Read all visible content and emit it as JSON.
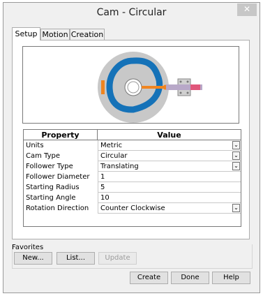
{
  "window": {
    "title": "Cam - Circular",
    "close_symbol": "✕"
  },
  "tabs": [
    {
      "label": "Setup",
      "active": true
    },
    {
      "label": "Motion",
      "active": false
    },
    {
      "label": "Creation",
      "active": false
    }
  ],
  "properties": {
    "header_property": "Property",
    "header_value": "Value",
    "rows": [
      {
        "name": "Units",
        "value": "Metric",
        "dropdown": true
      },
      {
        "name": "Cam Type",
        "value": "Circular",
        "dropdown": true
      },
      {
        "name": "Follower Type",
        "value": "Translating",
        "dropdown": true
      },
      {
        "name": "Follower Diameter",
        "value": "1",
        "dropdown": false
      },
      {
        "name": "Starting Radius",
        "value": "5",
        "dropdown": false
      },
      {
        "name": "Starting Angle",
        "value": "10",
        "dropdown": false
      },
      {
        "name": "Rotation Direction",
        "value": "Counter Clockwise",
        "dropdown": true
      }
    ]
  },
  "favorites": {
    "label": "Favorites",
    "new_label": "New...",
    "list_label": "List...",
    "update_label": "Update"
  },
  "footer": {
    "create_label": "Create",
    "done_label": "Done",
    "help_label": "Help"
  },
  "preview_colors": {
    "cam_disk": "#c8c8c8",
    "cam_track": "#1572b8",
    "follower": "#f0851f",
    "follower_end": "#e0567a"
  },
  "icons": {
    "dropdown": "chevron-down-icon",
    "close": "close-icon"
  }
}
